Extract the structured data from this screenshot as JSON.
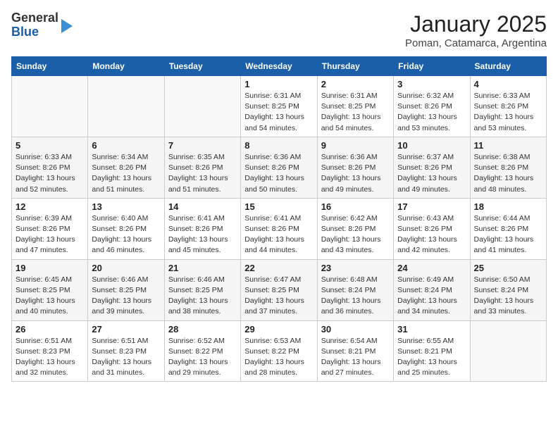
{
  "logo": {
    "line1": "General",
    "line2": "Blue"
  },
  "title": "January 2025",
  "subtitle": "Poman, Catamarca, Argentina",
  "weekdays": [
    "Sunday",
    "Monday",
    "Tuesday",
    "Wednesday",
    "Thursday",
    "Friday",
    "Saturday"
  ],
  "weeks": [
    [
      {
        "num": "",
        "info": ""
      },
      {
        "num": "",
        "info": ""
      },
      {
        "num": "",
        "info": ""
      },
      {
        "num": "1",
        "info": "Sunrise: 6:31 AM\nSunset: 8:25 PM\nDaylight: 13 hours\nand 54 minutes."
      },
      {
        "num": "2",
        "info": "Sunrise: 6:31 AM\nSunset: 8:25 PM\nDaylight: 13 hours\nand 54 minutes."
      },
      {
        "num": "3",
        "info": "Sunrise: 6:32 AM\nSunset: 8:26 PM\nDaylight: 13 hours\nand 53 minutes."
      },
      {
        "num": "4",
        "info": "Sunrise: 6:33 AM\nSunset: 8:26 PM\nDaylight: 13 hours\nand 53 minutes."
      }
    ],
    [
      {
        "num": "5",
        "info": "Sunrise: 6:33 AM\nSunset: 8:26 PM\nDaylight: 13 hours\nand 52 minutes."
      },
      {
        "num": "6",
        "info": "Sunrise: 6:34 AM\nSunset: 8:26 PM\nDaylight: 13 hours\nand 51 minutes."
      },
      {
        "num": "7",
        "info": "Sunrise: 6:35 AM\nSunset: 8:26 PM\nDaylight: 13 hours\nand 51 minutes."
      },
      {
        "num": "8",
        "info": "Sunrise: 6:36 AM\nSunset: 8:26 PM\nDaylight: 13 hours\nand 50 minutes."
      },
      {
        "num": "9",
        "info": "Sunrise: 6:36 AM\nSunset: 8:26 PM\nDaylight: 13 hours\nand 49 minutes."
      },
      {
        "num": "10",
        "info": "Sunrise: 6:37 AM\nSunset: 8:26 PM\nDaylight: 13 hours\nand 49 minutes."
      },
      {
        "num": "11",
        "info": "Sunrise: 6:38 AM\nSunset: 8:26 PM\nDaylight: 13 hours\nand 48 minutes."
      }
    ],
    [
      {
        "num": "12",
        "info": "Sunrise: 6:39 AM\nSunset: 8:26 PM\nDaylight: 13 hours\nand 47 minutes."
      },
      {
        "num": "13",
        "info": "Sunrise: 6:40 AM\nSunset: 8:26 PM\nDaylight: 13 hours\nand 46 minutes."
      },
      {
        "num": "14",
        "info": "Sunrise: 6:41 AM\nSunset: 8:26 PM\nDaylight: 13 hours\nand 45 minutes."
      },
      {
        "num": "15",
        "info": "Sunrise: 6:41 AM\nSunset: 8:26 PM\nDaylight: 13 hours\nand 44 minutes."
      },
      {
        "num": "16",
        "info": "Sunrise: 6:42 AM\nSunset: 8:26 PM\nDaylight: 13 hours\nand 43 minutes."
      },
      {
        "num": "17",
        "info": "Sunrise: 6:43 AM\nSunset: 8:26 PM\nDaylight: 13 hours\nand 42 minutes."
      },
      {
        "num": "18",
        "info": "Sunrise: 6:44 AM\nSunset: 8:26 PM\nDaylight: 13 hours\nand 41 minutes."
      }
    ],
    [
      {
        "num": "19",
        "info": "Sunrise: 6:45 AM\nSunset: 8:25 PM\nDaylight: 13 hours\nand 40 minutes."
      },
      {
        "num": "20",
        "info": "Sunrise: 6:46 AM\nSunset: 8:25 PM\nDaylight: 13 hours\nand 39 minutes."
      },
      {
        "num": "21",
        "info": "Sunrise: 6:46 AM\nSunset: 8:25 PM\nDaylight: 13 hours\nand 38 minutes."
      },
      {
        "num": "22",
        "info": "Sunrise: 6:47 AM\nSunset: 8:25 PM\nDaylight: 13 hours\nand 37 minutes."
      },
      {
        "num": "23",
        "info": "Sunrise: 6:48 AM\nSunset: 8:24 PM\nDaylight: 13 hours\nand 36 minutes."
      },
      {
        "num": "24",
        "info": "Sunrise: 6:49 AM\nSunset: 8:24 PM\nDaylight: 13 hours\nand 34 minutes."
      },
      {
        "num": "25",
        "info": "Sunrise: 6:50 AM\nSunset: 8:24 PM\nDaylight: 13 hours\nand 33 minutes."
      }
    ],
    [
      {
        "num": "26",
        "info": "Sunrise: 6:51 AM\nSunset: 8:23 PM\nDaylight: 13 hours\nand 32 minutes."
      },
      {
        "num": "27",
        "info": "Sunrise: 6:51 AM\nSunset: 8:23 PM\nDaylight: 13 hours\nand 31 minutes."
      },
      {
        "num": "28",
        "info": "Sunrise: 6:52 AM\nSunset: 8:22 PM\nDaylight: 13 hours\nand 29 minutes."
      },
      {
        "num": "29",
        "info": "Sunrise: 6:53 AM\nSunset: 8:22 PM\nDaylight: 13 hours\nand 28 minutes."
      },
      {
        "num": "30",
        "info": "Sunrise: 6:54 AM\nSunset: 8:21 PM\nDaylight: 13 hours\nand 27 minutes."
      },
      {
        "num": "31",
        "info": "Sunrise: 6:55 AM\nSunset: 8:21 PM\nDaylight: 13 hours\nand 25 minutes."
      },
      {
        "num": "",
        "info": ""
      }
    ]
  ]
}
